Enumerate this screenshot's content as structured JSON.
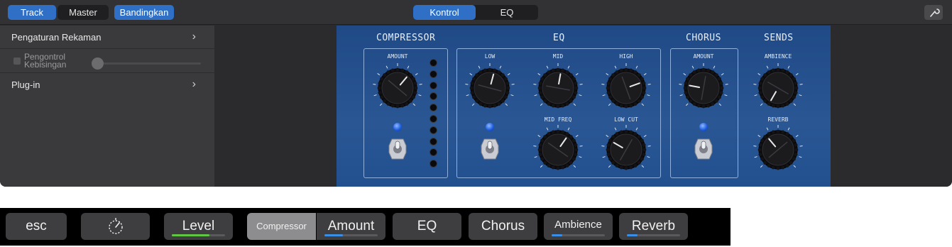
{
  "toolbar": {
    "track_label": "Track",
    "master_label": "Master",
    "compare_label": "Bandingkan",
    "controls_label": "Kontrol",
    "eq_label": "EQ",
    "wrench_icon": "wrench-icon"
  },
  "sidebar": {
    "recording_settings": "Pengaturan Rekaman",
    "noise_gate_line1": "Pengontrol",
    "noise_gate_line2": "Kebisingan",
    "plugins": "Plug-in"
  },
  "plugin": {
    "sections": {
      "compressor": "COMPRESSOR",
      "eq": "EQ",
      "chorus": "CHORUS",
      "sends": "SENDS"
    },
    "knobs": {
      "comp_amount": "AMOUNT",
      "low": "LOW",
      "mid": "MID",
      "high": "HIGH",
      "mid_freq": "MID FREQ",
      "low_cut": "LOW CUT",
      "chorus_amount": "AMOUNT",
      "ambience": "AMBIENCE",
      "reverb": "REVERB"
    },
    "colors": {
      "panel": "#2a5694",
      "led": "#1f5fe0"
    }
  },
  "touchbar": {
    "esc": "esc",
    "level": "Level",
    "level_value": 0.7,
    "compressor": "Compressor",
    "amount": "Amount",
    "amount_value": 0.35,
    "eq": "EQ",
    "chorus": "Chorus",
    "ambience": "Ambience",
    "ambience_value": 0.2,
    "reverb": "Reverb",
    "reverb_value": 0.2,
    "accent_green": "#5fc744",
    "accent_blue": "#3a8ee6",
    "tune_icon": "tuner-icon"
  }
}
